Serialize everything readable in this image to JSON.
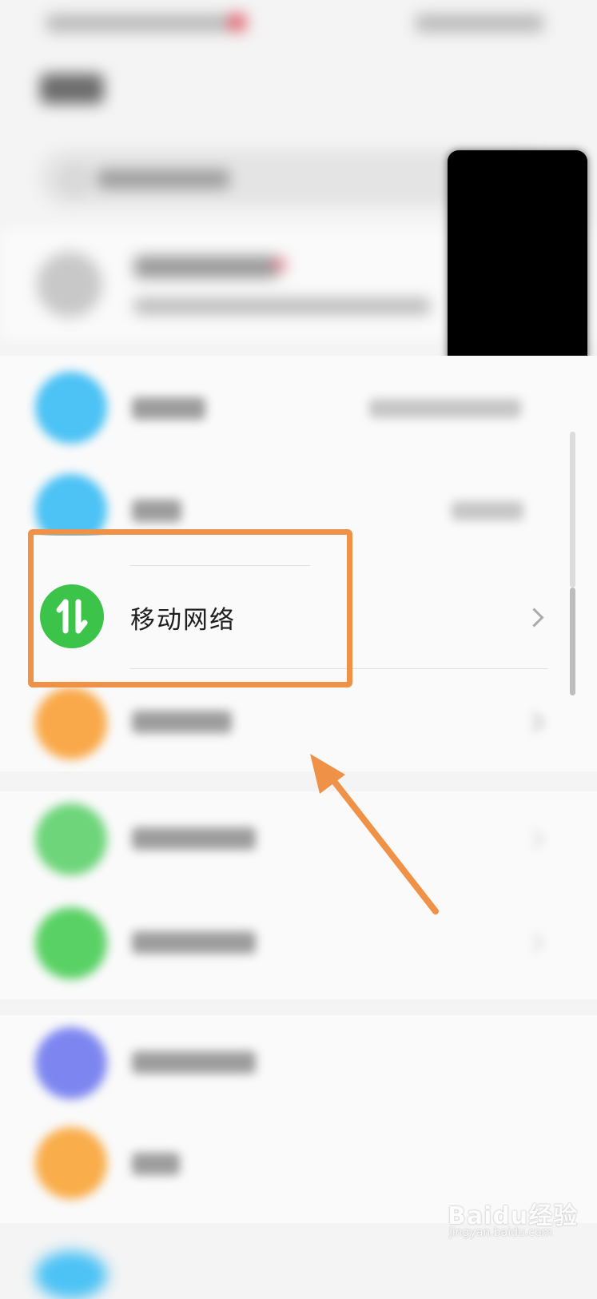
{
  "selected_row": {
    "label": "移动网络",
    "icon": "up-down-arrows-icon",
    "icon_color": "#3cc44a"
  },
  "blurred_row_colors": {
    "wlan": "#4cc2f5",
    "bluetooth": "#4cc2f5",
    "more_connections": "#f9a94a",
    "home_screen": "#6ed57b",
    "display": "#5ad165",
    "sounds": "#7d86f0",
    "notifications": "#f9ad4b"
  },
  "annotation": {
    "highlight_color": "#ef9248",
    "arrow_color": "#ef9248"
  },
  "watermark": {
    "main": "Baidu经验",
    "sub": "jingyan.baidu.com"
  }
}
